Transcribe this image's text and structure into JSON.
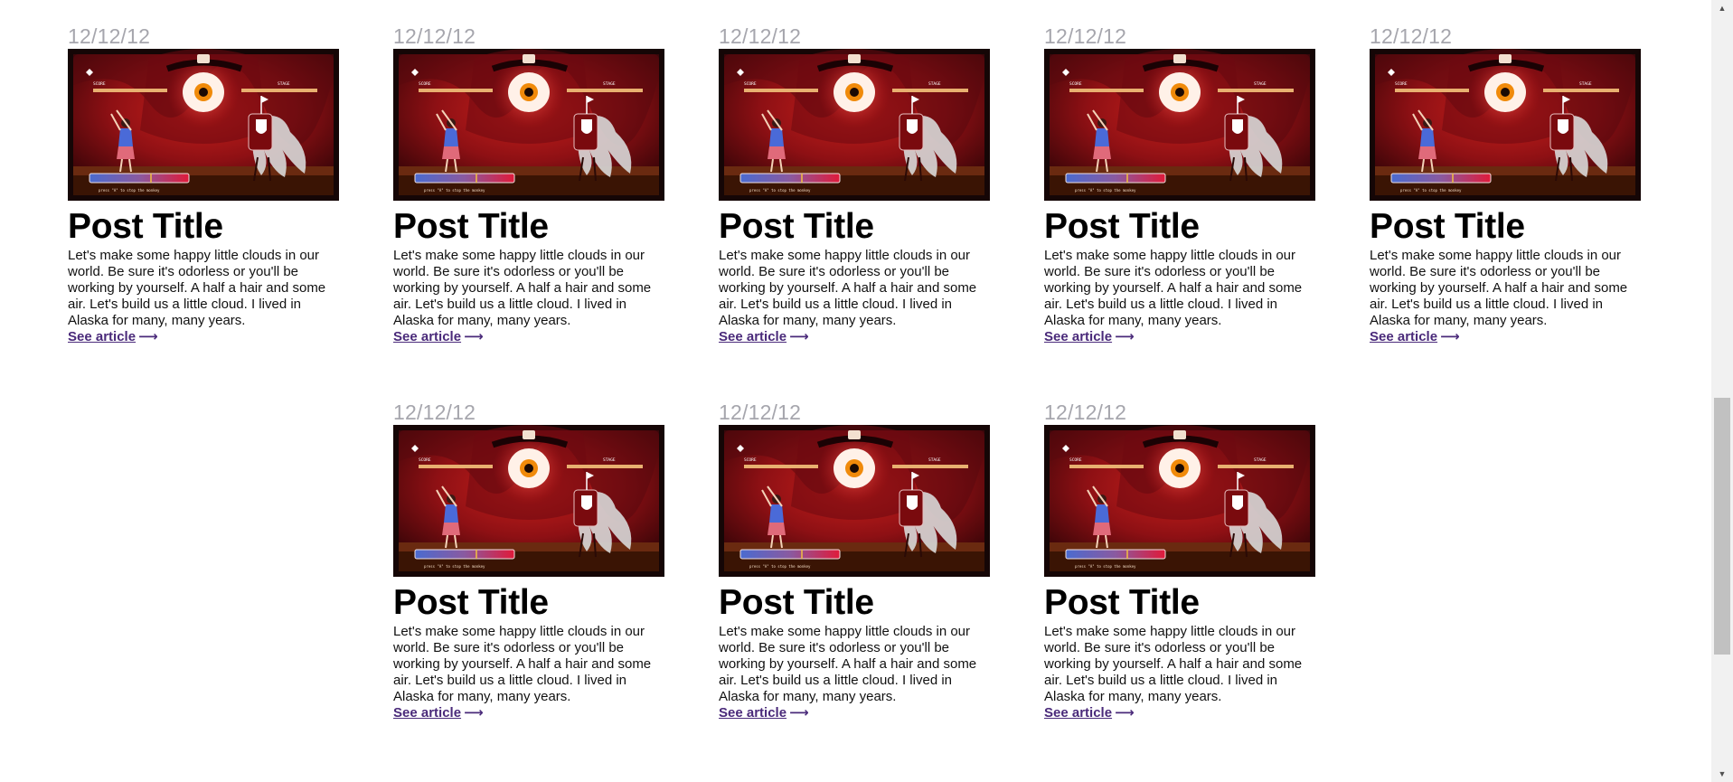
{
  "posts": [
    {
      "date": "12/12/12",
      "title": "Post Title",
      "excerpt": "Let's make some happy little clouds in our world. Be sure it's odorless or you'll be working by yourself. A half a hair and some air. Let's build us a little cloud. I lived in Alaska for many, many years.",
      "link": "See article",
      "arrow": "⟶"
    },
    {
      "date": "12/12/12",
      "title": "Post Title",
      "excerpt": "Let's make some happy little clouds in our world. Be sure it's odorless or you'll be working by yourself. A half a hair and some air. Let's build us a little cloud. I lived in Alaska for many, many years.",
      "link": "See article",
      "arrow": "⟶"
    },
    {
      "date": "12/12/12",
      "title": "Post Title",
      "excerpt": "Let's make some happy little clouds in our world. Be sure it's odorless or you'll be working by yourself. A half a hair and some air. Let's build us a little cloud. I lived in Alaska for many, many years.",
      "link": "See article",
      "arrow": "⟶"
    },
    {
      "date": "12/12/12",
      "title": "Post Title",
      "excerpt": "Let's make some happy little clouds in our world. Be sure it's odorless or you'll be working by yourself. A half a hair and some air. Let's build us a little cloud. I lived in Alaska for many, many years.",
      "link": "See article",
      "arrow": "⟶"
    },
    {
      "date": "12/12/12",
      "title": "Post Title",
      "excerpt": "Let's make some happy little clouds in our world. Be sure it's odorless or you'll be working by yourself. A half a hair and some air. Let's build us a little cloud. I lived in Alaska for many, many years.",
      "link": "See article",
      "arrow": "⟶"
    },
    {
      "date": "12/12/12",
      "title": "Post Title",
      "excerpt": "Let's make some happy little clouds in our world. Be sure it's odorless or you'll be working by yourself. A half a hair and some air. Let's build us a little cloud. I lived in Alaska for many, many years.",
      "link": "See article",
      "arrow": "⟶"
    },
    {
      "date": "12/12/12",
      "title": "Post Title",
      "excerpt": "Let's make some happy little clouds in our world. Be sure it's odorless or you'll be working by yourself. A half a hair and some air. Let's build us a little cloud. I lived in Alaska for many, many years.",
      "link": "See article",
      "arrow": "⟶"
    },
    {
      "date": "12/12/12",
      "title": "Post Title",
      "excerpt": "Let's make some happy little clouds in our world. Be sure it's odorless or you'll be working by yourself. A half a hair and some air. Let's build us a little cloud. I lived in Alaska for many, many years.",
      "link": "See article",
      "arrow": "⟶"
    }
  ],
  "thumbnail": {
    "icon": "game-screenshot-thumbnail",
    "caption_text": "press \"A\" to stop the monkey",
    "score_label": "SCORE",
    "stage_label": "STAGE"
  },
  "colors": {
    "date": "#a6a6ad",
    "link": "#4a2a7a",
    "title": "#000000"
  },
  "scrollbar": {
    "up_icon": "▲",
    "down_icon": "▼"
  }
}
